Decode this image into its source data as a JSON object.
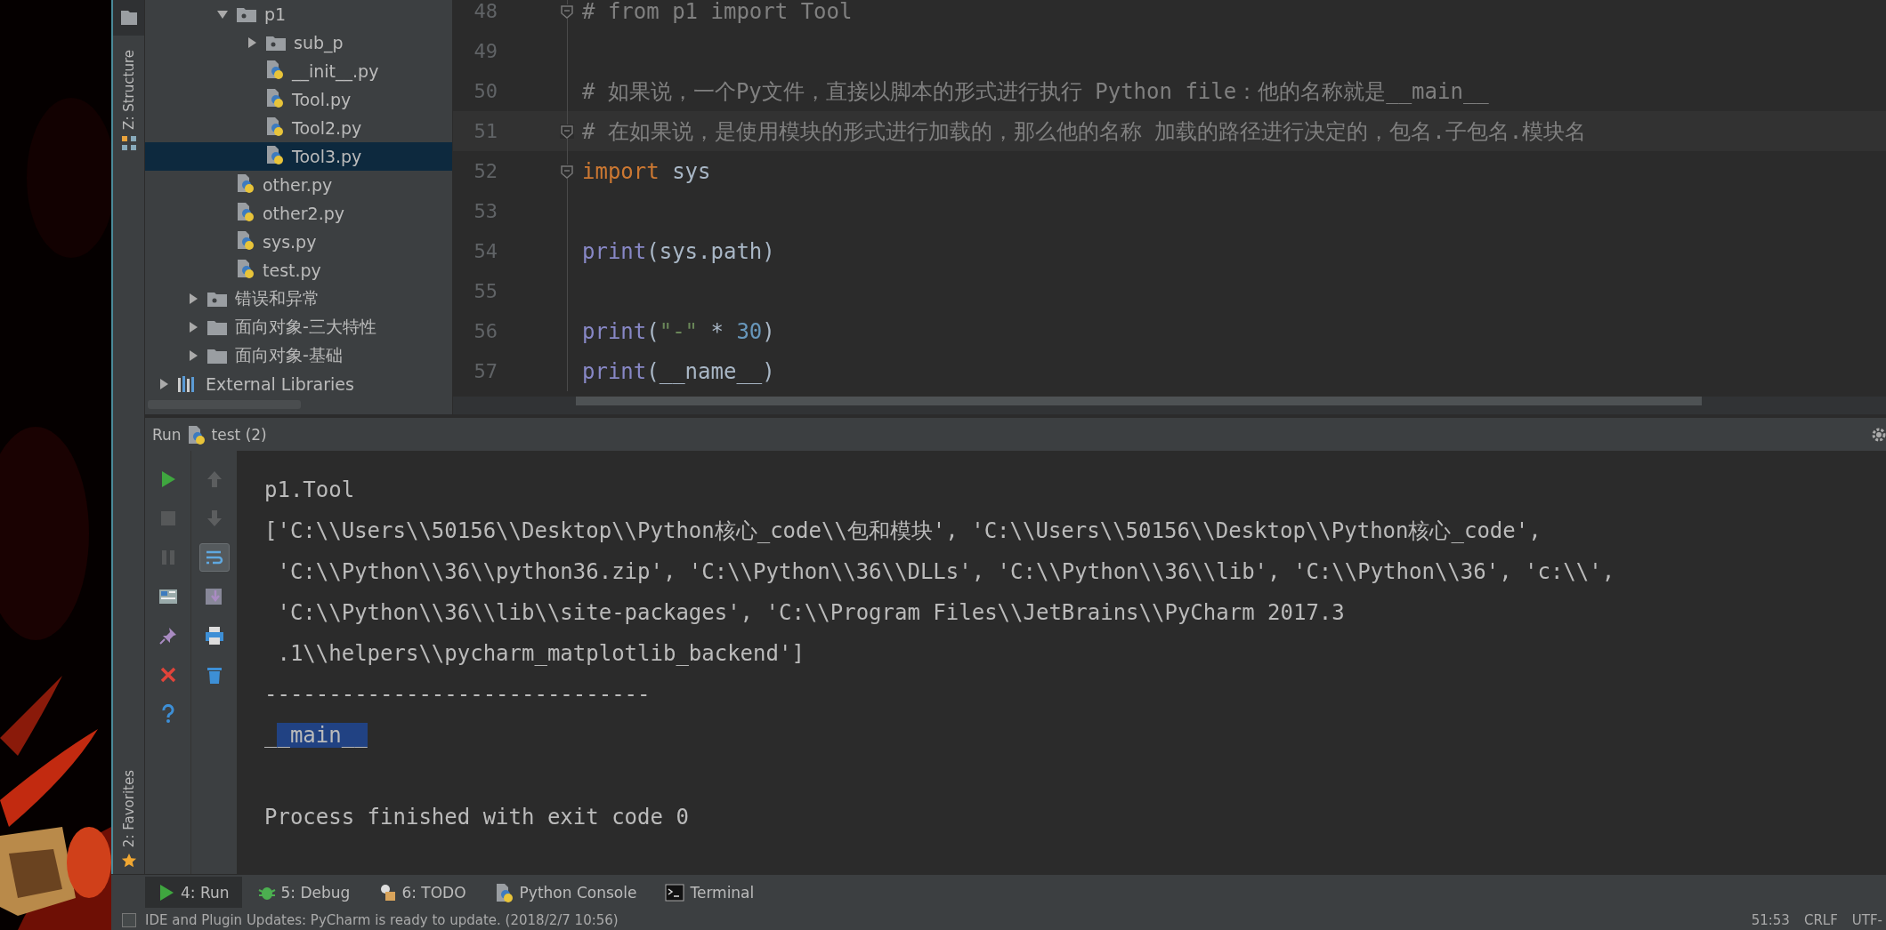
{
  "side_tabs": [
    {
      "label": "Z: Structure",
      "kind": "structure"
    },
    {
      "label": "2: Favorites",
      "kind": "favorites"
    }
  ],
  "project_tree": {
    "items": [
      {
        "children": [
          {
            "children": [
              {
                "label": "p1",
                "kind": "package",
                "expanded": true,
                "selected": false,
                "children": [
                  {
                    "label": "sub_p",
                    "kind": "package",
                    "expanded": false,
                    "selected": false
                  },
                  {
                    "label": "__init__.py",
                    "kind": "python",
                    "selected": false
                  },
                  {
                    "label": "Tool.py",
                    "kind": "python",
                    "selected": false
                  },
                  {
                    "label": "Tool2.py",
                    "kind": "python",
                    "selected": false
                  },
                  {
                    "label": "Tool3.py",
                    "kind": "python",
                    "selected": true
                  }
                ]
              },
              {
                "label": "other.py",
                "kind": "python",
                "selected": false
              },
              {
                "label": "other2.py",
                "kind": "python",
                "selected": false
              },
              {
                "label": "sys.py",
                "kind": "python",
                "selected": false
              },
              {
                "label": "test.py",
                "kind": "python",
                "selected": false
              }
            ]
          },
          {
            "label": "错误和异常",
            "kind": "package",
            "expanded": false,
            "selected": false
          },
          {
            "label": "面向对象-三大特性",
            "kind": "folder",
            "expanded": false,
            "selected": false
          },
          {
            "label": "面向对象-基础",
            "kind": "folder",
            "expanded": false,
            "selected": false
          }
        ]
      },
      {
        "label": "External Libraries",
        "kind": "libraries",
        "expanded": false,
        "selected": false
      }
    ]
  },
  "editor": {
    "lines": [
      {
        "number": "48",
        "fold": true,
        "current": false,
        "segments": [
          {
            "text": "# from p1 import Tool",
            "kind": "comment"
          }
        ]
      },
      {
        "number": "49",
        "fold": false,
        "current": false
      },
      {
        "number": "50",
        "fold": false,
        "current": false,
        "segments": [
          {
            "text": "# 如果说，一个Py文件，直接以脚本的形式进行执行 Python file：他的名称就是__main__",
            "kind": "comment"
          }
        ]
      },
      {
        "number": "51",
        "fold": true,
        "current": true,
        "segments": [
          {
            "text": "# 在如果说，是使用模块的形式进行加载的，那么他的名称 加载的路径进行决定的，包名.子包名.模块名",
            "kind": "comment"
          }
        ]
      },
      {
        "number": "52",
        "fold": true,
        "current": false,
        "segments": [
          {
            "text": "import",
            "kind": "keyword"
          },
          {
            "text": " sys",
            "kind": "plain"
          }
        ]
      },
      {
        "number": "53",
        "fold": false,
        "current": false
      },
      {
        "number": "54",
        "fold": false,
        "current": false,
        "segments": [
          {
            "text": "print",
            "kind": "builtin"
          },
          {
            "text": "(sys.path)",
            "kind": "plain"
          }
        ]
      },
      {
        "number": "55",
        "fold": false,
        "current": false
      },
      {
        "number": "56",
        "fold": false,
        "current": false,
        "segments": [
          {
            "text": "print",
            "kind": "builtin"
          },
          {
            "text": "(",
            "kind": "plain"
          },
          {
            "text": "\"-\"",
            "kind": "string"
          },
          {
            "text": " * ",
            "kind": "plain"
          },
          {
            "text": "30",
            "kind": "number"
          },
          {
            "text": ")",
            "kind": "plain"
          }
        ]
      },
      {
        "number": "57",
        "fold": false,
        "current": false,
        "segments": [
          {
            "text": "print",
            "kind": "builtin"
          },
          {
            "text": "(__name__)",
            "kind": "plain"
          }
        ]
      }
    ]
  },
  "run_panel": {
    "title": "Run",
    "config": "test (2)",
    "toolbar_left": [
      {
        "kind": "rerun",
        "disabled": false
      },
      {
        "kind": "stop",
        "disabled": true
      },
      {
        "kind": "pause",
        "disabled": true
      },
      {
        "kind": "layout",
        "disabled": false
      },
      {
        "kind": "pin",
        "disabled": false
      },
      {
        "kind": "close",
        "disabled": false
      },
      {
        "kind": "help",
        "disabled": false
      }
    ],
    "toolbar_right": [
      {
        "kind": "up",
        "disabled": true,
        "on": false
      },
      {
        "kind": "down",
        "disabled": true,
        "on": false
      },
      {
        "kind": "wrap",
        "disabled": false,
        "on": true
      },
      {
        "kind": "scroll-end",
        "disabled": false,
        "on": false
      },
      {
        "kind": "print",
        "disabled": false,
        "on": false
      },
      {
        "kind": "trash",
        "disabled": false,
        "on": false
      }
    ],
    "output": [
      {
        "kind": "text",
        "segments": [
          {
            "text": "p1.Tool",
            "selected": false
          }
        ]
      },
      {
        "kind": "text",
        "segments": [
          {
            "text": "['C:\\\\Users\\\\50156\\\\Desktop\\\\Python核心_code\\\\包和模块', 'C:\\\\Users\\\\50156\\\\Desktop\\\\Python核心_code',",
            "selected": false
          }
        ]
      },
      {
        "kind": "text",
        "segments": [
          {
            "text": " 'C:\\\\Python\\\\36\\\\python36.zip', 'C:\\\\Python\\\\36\\\\DLLs', 'C:\\\\Python\\\\36\\\\lib', 'C:\\\\Python\\\\36', 'c:\\\\',",
            "selected": false
          }
        ]
      },
      {
        "kind": "text",
        "segments": [
          {
            "text": " 'C:\\\\Python\\\\36\\\\lib\\\\site-packages', 'C:\\\\Program Files\\\\JetBrains\\\\PyCharm 2017.3",
            "selected": false
          }
        ]
      },
      {
        "kind": "text",
        "segments": [
          {
            "text": " .1\\\\helpers\\\\pycharm_matplotlib_backend']",
            "selected": false
          }
        ]
      },
      {
        "kind": "text",
        "segments": [
          {
            "text": "------------------------------",
            "selected": false
          }
        ]
      },
      {
        "kind": "text",
        "segments": [
          {
            "text": "_",
            "selected": false
          },
          {
            "text": "_main__",
            "selected": true
          }
        ]
      },
      {
        "kind": "exit",
        "segments": [
          {
            "text": "Process finished with exit code 0",
            "selected": false
          }
        ]
      }
    ]
  },
  "tool_tabs": [
    {
      "label": "4: Run",
      "kind": "run",
      "selected": true
    },
    {
      "label": "5: Debug",
      "kind": "debug",
      "selected": false
    },
    {
      "label": "6: TODO",
      "kind": "todo",
      "selected": false
    },
    {
      "label": "Python Console",
      "kind": "console",
      "selected": false
    },
    {
      "label": "Terminal",
      "kind": "terminal",
      "selected": false
    }
  ],
  "status_bar": {
    "message": "IDE and Plugin Updates: PyCharm is ready to update. (2018/2/7 10:56)",
    "position": "51:53",
    "line_separator": "CRLF",
    "encoding": "UTF-"
  }
}
